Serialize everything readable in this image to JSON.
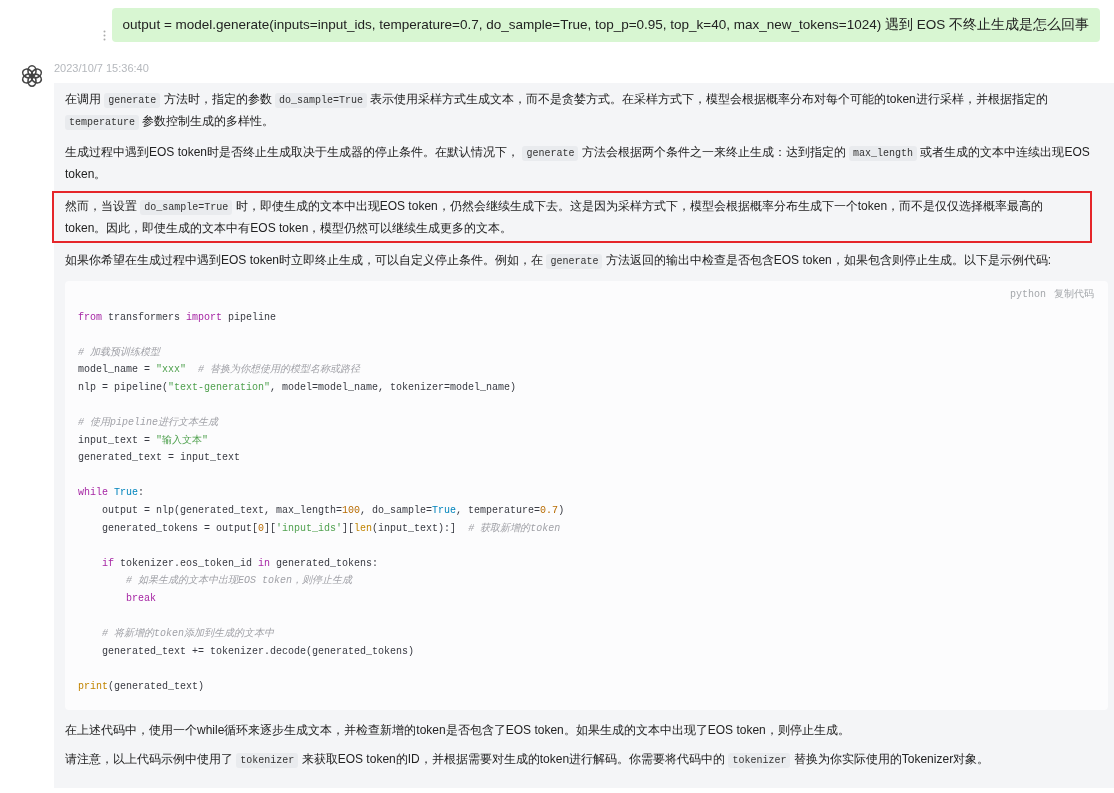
{
  "user_message": {
    "text": "output = model.generate(inputs=input_ids, temperature=0.7, do_sample=True, top_p=0.95, top_k=40, max_new_tokens=1024) 遇到 EOS 不终止生成是怎么回事"
  },
  "assistant": {
    "timestamp": "2023/10/7 15:36:40",
    "blocks": [
      {
        "kind": "paragraph",
        "highlighted": false,
        "segments": [
          {
            "kind": "text",
            "text": "在调用 "
          },
          {
            "kind": "code",
            "text": "generate"
          },
          {
            "kind": "text",
            "text": " 方法时，指定的参数 "
          },
          {
            "kind": "code",
            "text": "do_sample=True"
          },
          {
            "kind": "text",
            "text": " 表示使用采样方式生成文本，而不是贪婪方式。在采样方式下，模型会根据概率分布对每个可能的token进行采样，并根据指定的 "
          },
          {
            "kind": "code",
            "text": "temperature"
          },
          {
            "kind": "text",
            "text": " 参数控制生成的多样性。"
          }
        ]
      },
      {
        "kind": "paragraph",
        "highlighted": false,
        "segments": [
          {
            "kind": "text",
            "text": "生成过程中遇到EOS token时是否终止生成取决于生成器的停止条件。在默认情况下， "
          },
          {
            "kind": "code",
            "text": "generate"
          },
          {
            "kind": "text",
            "text": " 方法会根据两个条件之一来终止生成：达到指定的 "
          },
          {
            "kind": "code",
            "text": "max_length"
          },
          {
            "kind": "text",
            "text": " 或者生成的文本中连续出现EOS token。"
          }
        ]
      },
      {
        "kind": "paragraph",
        "highlighted": true,
        "segments": [
          {
            "kind": "text",
            "text": "然而，当设置 "
          },
          {
            "kind": "code",
            "text": "do_sample=True"
          },
          {
            "kind": "text",
            "text": " 时，即使生成的文本中出现EOS token，仍然会继续生成下去。这是因为采样方式下，模型会根据概率分布生成下一个token，而不是仅仅选择概率最高的token。因此，即使生成的文本中有EOS token，模型仍然可以继续生成更多的文本。"
          }
        ]
      },
      {
        "kind": "paragraph",
        "highlighted": false,
        "segments": [
          {
            "kind": "text",
            "text": "如果你希望在生成过程中遇到EOS token时立即终止生成，可以自定义停止条件。例如，在 "
          },
          {
            "kind": "code",
            "text": "generate"
          },
          {
            "kind": "text",
            "text": " 方法返回的输出中检查是否包含EOS token，如果包含则停止生成。以下是示例代码:"
          }
        ]
      },
      {
        "kind": "code_block",
        "language": "python",
        "copy_label": "复制代码",
        "lines": [
          {
            "kind": "code",
            "tokens": [
              {
                "kind": "keyword",
                "text": "from"
              },
              {
                "kind": "plain",
                "text": " transformers "
              },
              {
                "kind": "keyword",
                "text": "import"
              },
              {
                "kind": "plain",
                "text": " pipeline"
              }
            ]
          },
          {
            "kind": "blank"
          },
          {
            "kind": "code",
            "tokens": [
              {
                "kind": "comment",
                "text": "# 加载预训练模型"
              }
            ]
          },
          {
            "kind": "code",
            "tokens": [
              {
                "kind": "plain",
                "text": "model_name = "
              },
              {
                "kind": "string",
                "text": "\"xxx\""
              },
              {
                "kind": "comment",
                "text": "# 替换为你想使用的模型名称或路径"
              }
            ]
          },
          {
            "kind": "code",
            "tokens": [
              {
                "kind": "plain",
                "text": "nlp = pipeline("
              },
              {
                "kind": "string",
                "text": "\"text-generation\""
              },
              {
                "kind": "plain",
                "text": ", model=model_name, tokenizer=model_name)"
              }
            ]
          },
          {
            "kind": "blank"
          },
          {
            "kind": "code",
            "tokens": [
              {
                "kind": "comment",
                "text": "# 使用pipeline进行文本生成"
              }
            ]
          },
          {
            "kind": "code",
            "tokens": [
              {
                "kind": "plain",
                "text": "input_text = "
              },
              {
                "kind": "string",
                "text": "\"输入文本\""
              }
            ]
          },
          {
            "kind": "code",
            "tokens": [
              {
                "kind": "plain",
                "text": "generated_text = input_text"
              }
            ]
          },
          {
            "kind": "blank"
          },
          {
            "kind": "code",
            "tokens": [
              {
                "kind": "keyword",
                "text": "while"
              },
              {
                "kind": "constant",
                "text": " True"
              },
              {
                "kind": "plain",
                "text": ":"
              }
            ],
            "children": [
              {
                "kind": "code",
                "tokens": [
                  {
                    "kind": "plain",
                    "text": "output = nlp(generated_text, max_length="
                  },
                  {
                    "kind": "number",
                    "text": "100"
                  },
                  {
                    "kind": "plain",
                    "text": ", do_sample="
                  },
                  {
                    "kind": "constant",
                    "text": "True"
                  },
                  {
                    "kind": "plain",
                    "text": ", temperature="
                  },
                  {
                    "kind": "number",
                    "text": "0.7"
                  },
                  {
                    "kind": "plain",
                    "text": ")"
                  }
                ]
              },
              {
                "kind": "code",
                "tokens": [
                  {
                    "kind": "plain",
                    "text": "generated_tokens = output["
                  },
                  {
                    "kind": "number",
                    "text": "0"
                  },
                  {
                    "kind": "plain",
                    "text": "]["
                  },
                  {
                    "kind": "string",
                    "text": "'input_ids'"
                  },
                  {
                    "kind": "plain",
                    "text": "]["
                  },
                  {
                    "kind": "builtin",
                    "text": "len"
                  },
                  {
                    "kind": "plain",
                    "text": "(input_text):]"
                  },
                  {
                    "kind": "comment",
                    "text": "# 获取新增的token"
                  }
                ]
              },
              {
                "kind": "blank"
              },
              {
                "kind": "code",
                "tokens": [
                  {
                    "kind": "keyword",
                    "text": "if"
                  },
                  {
                    "kind": "plain",
                    "text": " tokenizer.eos_token_id "
                  },
                  {
                    "kind": "keyword",
                    "text": "in"
                  },
                  {
                    "kind": "plain",
                    "text": " generated_tokens:"
                  }
                ],
                "children": [
                  {
                    "kind": "code",
                    "tokens": [
                      {
                        "kind": "comment",
                        "text": "# 如果生成的文本中出现EOS token，则停止生成"
                      }
                    ]
                  },
                  {
                    "kind": "code",
                    "tokens": [
                      {
                        "kind": "keyword",
                        "text": "break"
                      }
                    ]
                  }
                ]
              },
              {
                "kind": "blank"
              },
              {
                "kind": "code",
                "tokens": [
                  {
                    "kind": "comment",
                    "text": "# 将新增的token添加到生成的文本中"
                  }
                ]
              },
              {
                "kind": "code",
                "tokens": [
                  {
                    "kind": "plain",
                    "text": "generated_text += tokenizer.decode(generated_tokens)"
                  }
                ]
              }
            ]
          },
          {
            "kind": "blank"
          },
          {
            "kind": "code",
            "tokens": [
              {
                "kind": "builtin",
                "text": "print"
              },
              {
                "kind": "plain",
                "text": "(generated_text)"
              }
            ]
          }
        ]
      },
      {
        "kind": "paragraph",
        "highlighted": false,
        "segments": [
          {
            "kind": "text",
            "text": "在上述代码中，使用一个while循环来逐步生成文本，并检查新增的token是否包含了EOS token。如果生成的文本中出现了EOS token，则停止生成。"
          }
        ]
      },
      {
        "kind": "paragraph",
        "highlighted": false,
        "segments": [
          {
            "kind": "text",
            "text": "请注意，以上代码示例中使用了 "
          },
          {
            "kind": "code",
            "text": "tokenizer"
          },
          {
            "kind": "text",
            "text": " 来获取EOS token的ID，并根据需要对生成的token进行解码。你需要将代码中的 "
          },
          {
            "kind": "code",
            "text": "tokenizer"
          },
          {
            "kind": "text",
            "text": " 替换为你实际使用的Tokenizer对象。"
          }
        ]
      }
    ]
  }
}
